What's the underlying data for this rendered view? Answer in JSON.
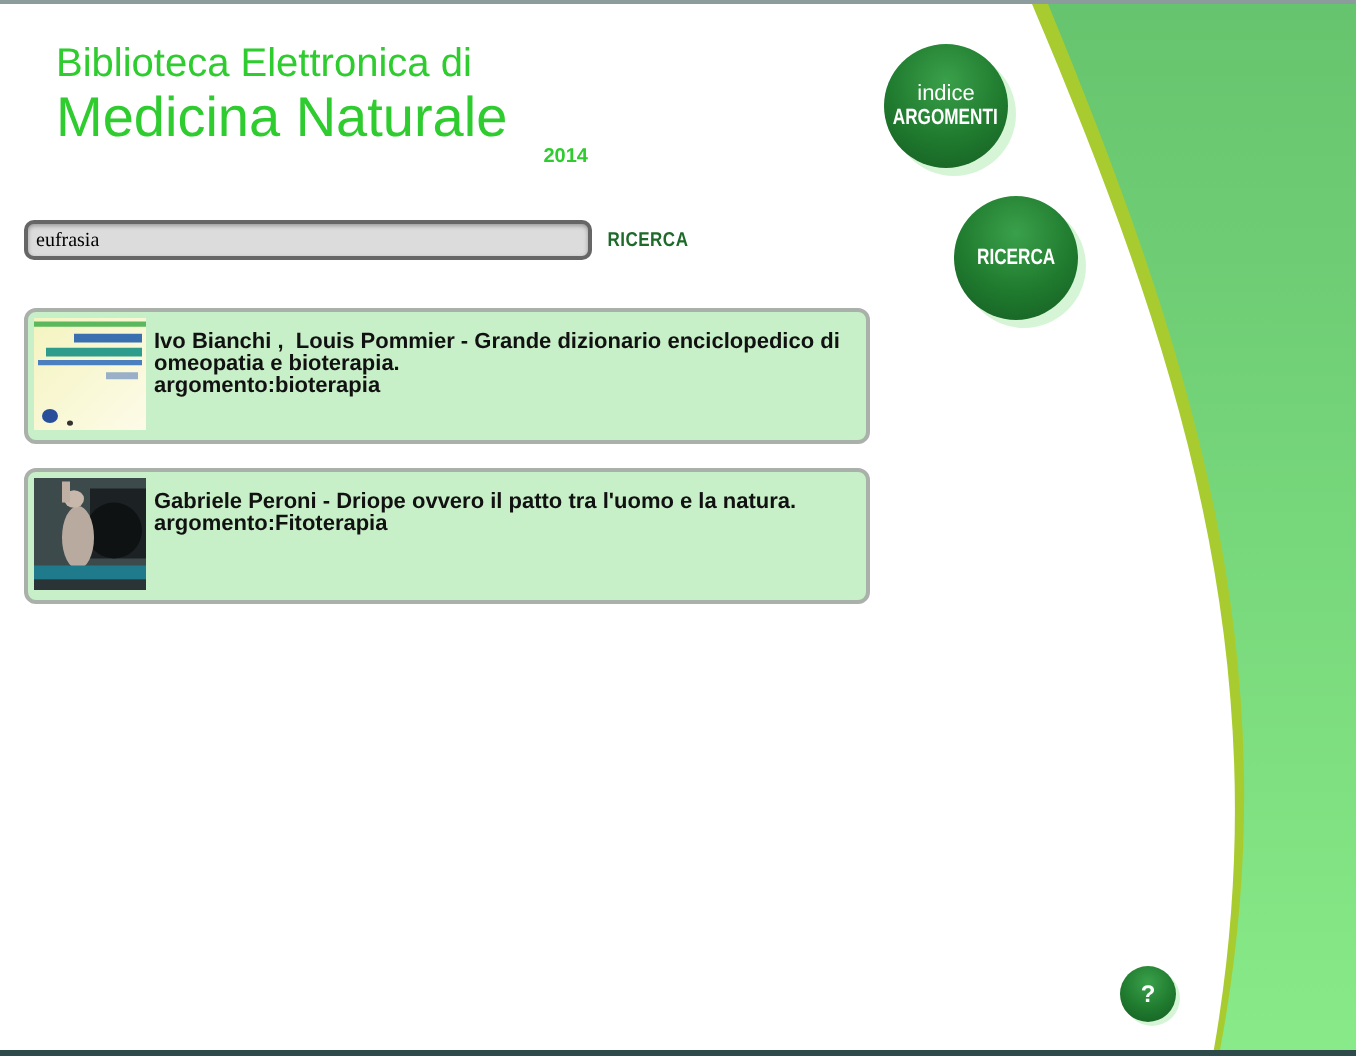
{
  "header": {
    "title_line1": "Biblioteca Elettronica di",
    "title_line2": "Medicina Naturale",
    "year": "2014"
  },
  "search": {
    "value": "eufrasia",
    "button": "RICERCA"
  },
  "results": [
    {
      "title": "Ivo Bianchi ,  Louis Pommier - Grande dizionario enciclopedico di omeopatia e bioterapia.",
      "topic": "argomento:bioterapia"
    },
    {
      "title": "Gabriele Peroni - Driope ovvero il patto tra l'uomo e la natura.",
      "topic": "argomento:Fitoterapia"
    }
  ],
  "nav_buttons": [
    {
      "lines": [
        "indice",
        "ARGOMENTI"
      ]
    },
    {
      "lines": [
        "RICERCA"
      ]
    }
  ],
  "help_button": "?"
}
